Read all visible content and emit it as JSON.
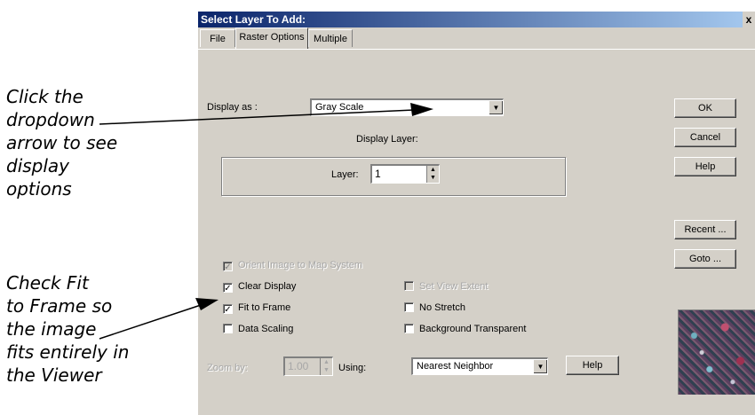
{
  "annotations": {
    "callout1": [
      "Click the",
      "dropdown",
      "arrow to see",
      "display",
      "options"
    ],
    "callout2": [
      "Check Fit",
      "to Frame so",
      "the image",
      "fits entirely in",
      "the Viewer"
    ]
  },
  "dialog": {
    "title": "Select Layer To Add:",
    "close": "x",
    "tabs": [
      "File",
      "Raster Options",
      "Multiple"
    ],
    "display_as_label": "Display as :",
    "display_as_value": "Gray Scale",
    "display_layer_label": "Display Layer:",
    "layer_label": "Layer:",
    "layer_value": "1",
    "buttons": {
      "ok": "OK",
      "cancel": "Cancel",
      "help": "Help",
      "recent": "Recent ...",
      "goto": "Goto ..."
    },
    "checkboxes": {
      "orient": {
        "label": "Orient Image to Map System",
        "checked": true,
        "enabled": false
      },
      "clear_display": {
        "label": "Clear Display",
        "checked": true,
        "enabled": true
      },
      "set_view_extent": {
        "label": "Set View Extent",
        "checked": false,
        "enabled": false
      },
      "fit_to_frame": {
        "label": "Fit to Frame",
        "checked": true,
        "enabled": true
      },
      "no_stretch": {
        "label": "No Stretch",
        "checked": false,
        "enabled": true
      },
      "data_scaling": {
        "label": "Data Scaling",
        "checked": false,
        "enabled": true
      },
      "background_transparent": {
        "label": "Background Transparent",
        "checked": false,
        "enabled": true
      }
    },
    "zoom_label": "Zoom by:",
    "zoom_value": "1.00",
    "using_label": "Using:",
    "using_value": "Nearest Neighbor",
    "help_bottom": "Help"
  }
}
